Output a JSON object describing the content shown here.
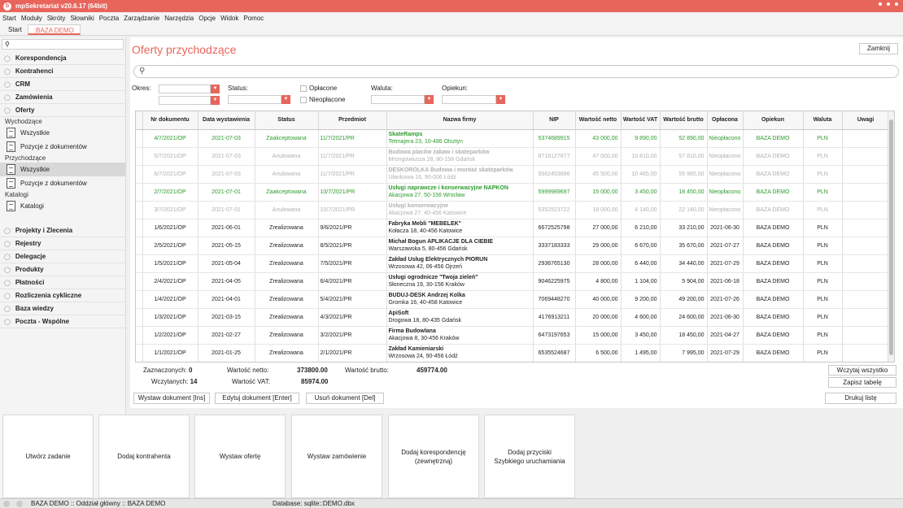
{
  "app": {
    "title": "mpSekretariat v20.6.17 (64bit)"
  },
  "menu": [
    "Start",
    "Moduły",
    "Skróty",
    "Słowniki",
    "Poczta",
    "Zarządzanie",
    "Narzędzia",
    "Opcje",
    "Widok",
    "Pomoc"
  ],
  "tabs": {
    "start": "Start",
    "active": ":BAZA DEMO"
  },
  "sidebar": {
    "search_placeholder": "",
    "sections_top": [
      "Korespondencja",
      "Kontrahenci",
      "CRM",
      "Zamówienia",
      "Oferty"
    ],
    "oferty": {
      "wychodzace_label": "Wychodzące",
      "wychodzace_items": [
        "Wszystkie",
        "Pozycje z dokumentów"
      ],
      "przychodzace_label": "Przychodzące",
      "przychodzace_items": [
        "Wszystkie",
        "Pozycje z dokumentów"
      ],
      "katalogi_label": "Katalogi",
      "katalogi_items": [
        "Katalogi"
      ]
    },
    "sections_bottom": [
      "Projekty i Zlecenia",
      "Rejestry",
      "Delegacje",
      "Produkty",
      "Płatności",
      "Rozliczenia cykliczne",
      "Baza wiedzy",
      "Poczta - Wspólne"
    ]
  },
  "main": {
    "title": "Oferty przychodzące",
    "close_button": "Zamknij",
    "filters": {
      "okres": "Okres:",
      "status": "Status:",
      "oplacone": "Opłacone",
      "nieoplacone": "Nieopłacone",
      "waluta": "Waluta:",
      "opiekun": "Opiekun:"
    },
    "columns": [
      "Nr dokumentu",
      "Data wystawienia",
      "Status",
      "Przedmiot",
      "Nazwa firmy",
      "NIP",
      "Wartość netto",
      "Wartość VAT",
      "Wartość brutto",
      "Opłacona",
      "Opiekun",
      "Waluta",
      "Uwagi"
    ],
    "rows": [
      {
        "style": "green",
        "nr": "4/7/2021/OP",
        "data": "2021-07-03",
        "status": "Zaakceptowana",
        "przedmiot": "11/7/2021/PR",
        "firma": "SkateRamps",
        "adres": "Tetmajera 23, 10-486 Olsztyn",
        "nip": "5374689915",
        "netto": "43 000,00",
        "vat": "9 890,00",
        "brutto": "52 890,00",
        "oplacona": "Nieopłacono",
        "opiekun": "BAZA DEMO",
        "waluta": "PLN",
        "uwagi": ""
      },
      {
        "style": "grey",
        "nr": "5/7/2021/OP",
        "data": "2021-07-03",
        "status": "Anulowana",
        "przedmiot": "11/7/2021/PR",
        "firma": "Budowa placów zabaw i skateparków",
        "adres": "Mrongowiusza 28, 80-158 Gdańsk",
        "nip": "8718127877",
        "netto": "47 000,00",
        "vat": "10 810,00",
        "brutto": "57 810,00",
        "oplacona": "Nieopłacono",
        "opiekun": "BAZA DEMO",
        "waluta": "PLN",
        "uwagi": ""
      },
      {
        "style": "grey",
        "nr": "6/7/2021/OP",
        "data": "2021-07-03",
        "status": "Anulowana",
        "przedmiot": "11/7/2021/PR",
        "firma": "DESKOROLKA Budowa i montaż skateparków",
        "adres": "Ułankowa 16, 90-006 Łódź",
        "nip": "5562453896",
        "netto": "45 500,00",
        "vat": "10 465,00",
        "brutto": "55 965,00",
        "oplacona": "Nieopłacono",
        "opiekun": "BAZA DEMO",
        "waluta": "PLN",
        "uwagi": ""
      },
      {
        "style": "green",
        "nr": "2/7/2021/OP",
        "data": "2021-07-01",
        "status": "Zaakceptowana",
        "przedmiot": "10/7/2021/PR",
        "firma": "Usługi naprawcze i konserwacyjne NAPKON",
        "adres": "Akacjowa 27, 50-156 Wrocław",
        "nip": "5999989697",
        "netto": "15 000,00",
        "vat": "3 450,00",
        "brutto": "18 450,00",
        "oplacona": "Nieopłacono",
        "opiekun": "BAZA DEMO",
        "waluta": "PLN",
        "uwagi": ""
      },
      {
        "style": "grey",
        "nr": "3/7/2021/OP",
        "data": "2021-07-01",
        "status": "Anulowana",
        "przedmiot": "10/7/2021/PR",
        "firma": "Usługi konserwacyjne",
        "adres": "Akacjowa 27, 40-456 Katowice",
        "nip": "5352523722",
        "netto": "18 000,00",
        "vat": "4 140,00",
        "brutto": "22 140,00",
        "oplacona": "Nieopłacono",
        "opiekun": "BAZA DEMO",
        "waluta": "PLN",
        "uwagi": ""
      },
      {
        "style": "dark",
        "nr": "1/6/2021/OP",
        "data": "2021-06-01",
        "status": "Zrealizowana",
        "przedmiot": "9/6/2021/PR",
        "firma": "Fabryka Mebli \"MEBELEK\"",
        "adres": "Kołacza 18, 40-456 Katowice",
        "nip": "6672525798",
        "netto": "27 000,00",
        "vat": "6 210,00",
        "brutto": "33 210,00",
        "oplacona": "2021-06-30",
        "opiekun": "BAZA DEMO",
        "waluta": "PLN",
        "uwagi": ""
      },
      {
        "style": "dark",
        "nr": "2/5/2021/OP",
        "data": "2021-05-15",
        "status": "Zrealizowana",
        "przedmiot": "8/5/2021/PR",
        "firma": "Michał Bogun APLIKACJE DLA CIEBIE",
        "adres": "Warszawska 5, 80-456 Gdańsk",
        "nip": "3337183333",
        "netto": "29 000,00",
        "vat": "6 670,00",
        "brutto": "35 670,00",
        "oplacona": "2021-07-27",
        "opiekun": "BAZA DEMO",
        "waluta": "PLN",
        "uwagi": ""
      },
      {
        "style": "dark",
        "nr": "1/5/2021/OP",
        "data": "2021-05-04",
        "status": "Zrealizowana",
        "przedmiot": "7/5/2021/PR",
        "firma": "Zakład Usług Elektrycznych PIORUN",
        "adres": "Wrzosowa 42, 06-456 Ojrzeń",
        "nip": "2936765130",
        "netto": "28 000,00",
        "vat": "6 440,00",
        "brutto": "34 440,00",
        "oplacona": "2021-07-29",
        "opiekun": "BAZA DEMO",
        "waluta": "PLN",
        "uwagi": ""
      },
      {
        "style": "dark",
        "nr": "2/4/2021/OP",
        "data": "2021-04-05",
        "status": "Zrealizowana",
        "przedmiot": "6/4/2021/PR",
        "firma": "Usługi ogrodnicze \"Twoja zieleń\"",
        "adres": "Słoneczna 19, 30-156 Kraków",
        "nip": "9046225975",
        "netto": "4 800,00",
        "vat": "1 104,00",
        "brutto": "5 904,00",
        "oplacona": "2021-06-18",
        "opiekun": "BAZA DEMO",
        "waluta": "PLN",
        "uwagi": ""
      },
      {
        "style": "dark",
        "nr": "1/4/2021/OP",
        "data": "2021-04-01",
        "status": "Zrealizowana",
        "przedmiot": "5/4/2021/PR",
        "firma": "BUDUJ-DESK Andrzej Kolka",
        "adres": "Gromka 16, 40-458 Katowice",
        "nip": "7069448270",
        "netto": "40 000,00",
        "vat": "9 200,00",
        "brutto": "49 200,00",
        "oplacona": "2021-07-26",
        "opiekun": "BAZA DEMO",
        "waluta": "PLN",
        "uwagi": ""
      },
      {
        "style": "dark",
        "nr": "1/3/2021/OP",
        "data": "2021-03-15",
        "status": "Zrealizowana",
        "przedmiot": "4/3/2021/PR",
        "firma": "ApiSoft",
        "adres": "Drogowa 18, 80-435 Gdańsk",
        "nip": "4176913211",
        "netto": "20 000,00",
        "vat": "4 600,00",
        "brutto": "24 600,00",
        "oplacona": "2021-06-30",
        "opiekun": "BAZA DEMO",
        "waluta": "PLN",
        "uwagi": ""
      },
      {
        "style": "dark",
        "nr": "1/2/2021/OP",
        "data": "2021-02-27",
        "status": "Zrealizowana",
        "przedmiot": "3/2/2021/PR",
        "firma": "Firma Budowlana",
        "adres": "Akacjowa 8, 30-456 Kraków",
        "nip": "6473197653",
        "netto": "15 000,00",
        "vat": "3 450,00",
        "brutto": "18 450,00",
        "oplacona": "2021-04-27",
        "opiekun": "BAZA DEMO",
        "waluta": "PLN",
        "uwagi": ""
      },
      {
        "style": "dark",
        "nr": "1/1/2021/OP",
        "data": "2021-01-25",
        "status": "Zrealizowana",
        "przedmiot": "2/1/2021/PR",
        "firma": "Zakład Kamieniarski",
        "adres": "Wrzosowa 24, 90-456 Łódź",
        "nip": "6535524687",
        "netto": "6 500,00",
        "vat": "1 495,00",
        "brutto": "7 995,00",
        "oplacona": "2021-07-29",
        "opiekun": "BAZA DEMO",
        "waluta": "PLN",
        "uwagi": ""
      }
    ],
    "summary": {
      "zaznaczonych_label": "Zaznaczonych:",
      "zaznaczonych": "0",
      "wczytanych_label": "Wczytanych:",
      "wczytanych": "14",
      "netto_label": "Wartość netto:",
      "netto": "373800.00",
      "vat_label": "Wartość VAT:",
      "vat": "85974.00",
      "brutto_label": "Wartość brutto:",
      "brutto": "459774.00",
      "wczytaj_button": "Wczytaj wszystko",
      "zapisz_button": "Zapisz tabelę"
    },
    "actions": {
      "wystaw": "Wystaw dokument [Ins]",
      "edytuj": "Edytuj dokument [Enter]",
      "usun": "Usuń dokument [Del]",
      "drukuj": "Drukuj listę"
    }
  },
  "tiles": [
    "Utwórz zadanie",
    "Dodaj kontrahenta",
    "Wystaw ofertę",
    "Wystaw zamówienie",
    "Dodaj korespondencję\n(zewnętrzną)",
    "Dodaj przyciski\nSzybkiego uruchamiania"
  ],
  "statusbar": {
    "left": "BAZA DEMO :: Oddział główny :: BAZA DEMO",
    "db": "Database: sqlite::DEMO.dbx"
  },
  "colors": {
    "accent": "#e8655b",
    "accepted": "#2e9b2e",
    "cancelled": "#b0b0b0"
  }
}
